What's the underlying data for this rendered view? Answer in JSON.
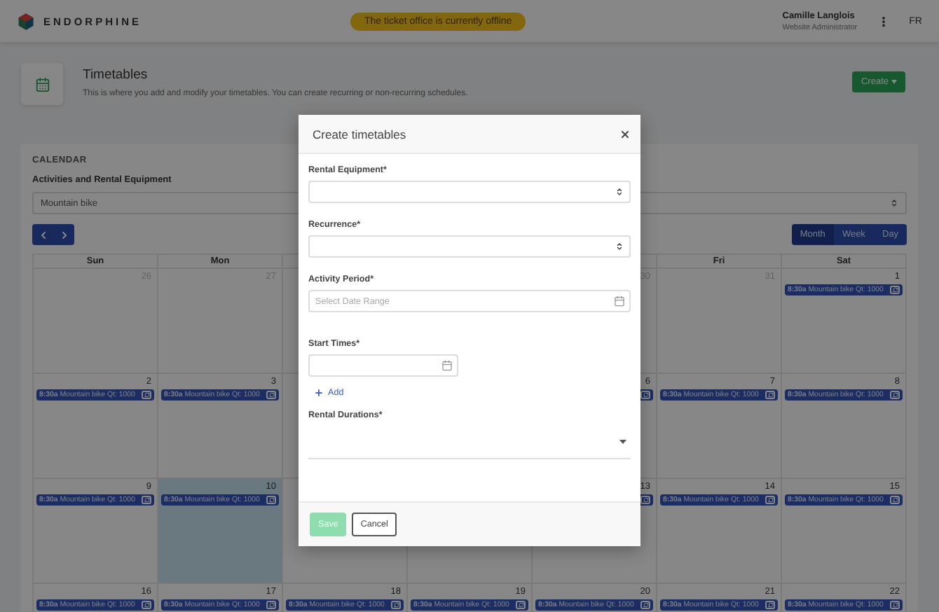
{
  "header": {
    "brand": "ENDORPHINE",
    "notice": "The ticket office is currently offline",
    "user": {
      "name": "Camille Langlois",
      "role": "Website Administrator"
    },
    "language": "FR"
  },
  "page": {
    "title": "Timetables",
    "description": "This is where you add and modify your timetables. You can create recurring or non-recurring schedules.",
    "create_button": "Create"
  },
  "calendar": {
    "heading": "CALENDAR",
    "filter_label": "Activities and Rental Equipment",
    "filter_value": "Mountain bike",
    "views": [
      {
        "label": "Month",
        "selected": true
      },
      {
        "label": "Week",
        "selected": false
      },
      {
        "label": "Day",
        "selected": false
      }
    ],
    "weekdays": {
      "sun": "Sun",
      "mon": "Mon",
      "fri": "Fri",
      "sat": "Sat"
    },
    "weeks": [
      {
        "cells": [
          {
            "day": "26",
            "other_month": true
          },
          {
            "day": "27",
            "other_month": true
          },
          {},
          {},
          {
            "day": "30",
            "other_month": true
          },
          {
            "day": "31",
            "other_month": true
          },
          {
            "day": "1",
            "other_month": false,
            "event": {
              "time": "8:30a",
              "title": "Mountain bike Qt: 1000",
              "recurring": true
            }
          }
        ]
      },
      {
        "cells": [
          {
            "day": "2",
            "other_month": false,
            "event": {
              "time": "8:30a",
              "title": "Mountain bike Qt: 1000",
              "recurring": true
            }
          },
          {
            "day": "3",
            "other_month": false,
            "event": {
              "time": "8:30a",
              "title": "Mountain bike Qt: 1000",
              "recurring": true
            }
          },
          {},
          {},
          {
            "day": "6",
            "other_month": false,
            "event": {
              "recurring": true
            }
          },
          {
            "day": "7",
            "other_month": false,
            "event": {
              "time": "8:30a",
              "title": "Mountain bike Qt: 1000",
              "recurring": true
            }
          },
          {
            "day": "8",
            "other_month": false,
            "event": {
              "time": "8:30a",
              "title": "Mountain bike Qt: 1000",
              "recurring": true
            }
          }
        ]
      },
      {
        "cells": [
          {
            "day": "9",
            "other_month": false,
            "event": {
              "time": "8:30a",
              "title": "Mountain bike Qt: 1000",
              "recurring": true
            }
          },
          {
            "day": "10",
            "other_month": false,
            "today": true,
            "event": {
              "time": "8:30a",
              "title": "Mountain bike Qt: 1000",
              "recurring": true
            }
          },
          {},
          {},
          {
            "day": "13",
            "other_month": false,
            "event": {
              "recurring": true
            }
          },
          {
            "day": "14",
            "other_month": false,
            "event": {
              "time": "8:30a",
              "title": "Mountain bike Qt: 1000",
              "recurring": true
            }
          },
          {
            "day": "15",
            "other_month": false,
            "event": {
              "time": "8:30a",
              "title": "Mountain bike Qt: 1000",
              "recurring": true
            }
          }
        ]
      },
      {
        "cells": [
          {
            "day": "16",
            "other_month": false,
            "event": {
              "time": "8:30a",
              "title": "Mountain bike Qt: 1000",
              "recurring": true
            }
          },
          {
            "day": "17",
            "other_month": false,
            "event": {
              "time": "8:30a",
              "title": "Mountain bike Qt: 1000",
              "recurring": true
            }
          },
          {
            "day": "18",
            "other_month": false,
            "event": {
              "time": "8:30a",
              "title": "Mountain bike Qt: 1000",
              "recurring": true
            }
          },
          {
            "day": "19",
            "other_month": false,
            "event": {
              "time": "8:30a",
              "title": "Mountain bike Qt: 1000",
              "recurring": true
            }
          },
          {
            "day": "20",
            "other_month": false,
            "event": {
              "time": "8:30a",
              "title": "Mountain bike Qt: 1000",
              "recurring": true
            }
          },
          {
            "day": "21",
            "other_month": false,
            "event": {
              "time": "8:30a",
              "title": "Mountain bike Qt: 1000",
              "recurring": true
            }
          },
          {
            "day": "22",
            "other_month": false,
            "event": {
              "time": "8:30a",
              "title": "Mountain bike Qt: 1000",
              "recurring": true
            }
          }
        ]
      }
    ]
  },
  "modal": {
    "title": "Create timetables",
    "fields": [
      {
        "kind": "select",
        "label": "Rental Equipment*"
      },
      {
        "kind": "select",
        "label": "Recurrence*"
      },
      {
        "kind": "date",
        "label": "Activity Period*",
        "placeholder": "Select Date Range"
      },
      {
        "kind": "time",
        "label": "Start Times*",
        "add_label": "Add"
      },
      {
        "kind": "multiselect",
        "label": "Rental Durations*"
      }
    ],
    "buttons": [
      {
        "label": "Save",
        "kind": "primary",
        "disabled": true
      },
      {
        "label": "Cancel",
        "kind": "secondary",
        "disabled": false
      }
    ]
  }
}
